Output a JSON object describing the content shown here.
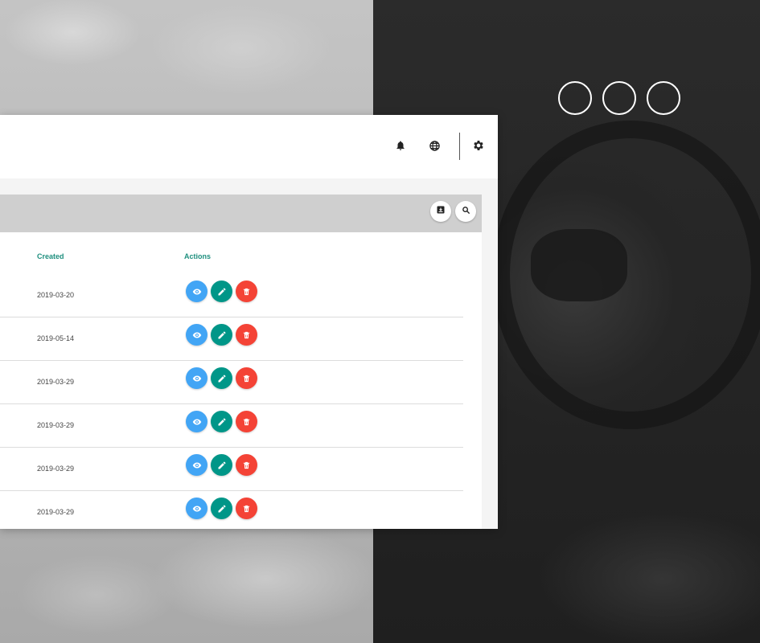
{
  "colors": {
    "accent": "#1e8f7e",
    "view": "#42a5f5",
    "edit": "#009688",
    "delete": "#f44336"
  },
  "topbar": {
    "icons": [
      "bell-icon",
      "globe-icon",
      "gear-icon"
    ]
  },
  "card_header": {
    "icons": [
      "download-icon",
      "search-icon"
    ]
  },
  "table": {
    "columns": {
      "created": "Created",
      "actions": "Actions"
    },
    "rows": [
      {
        "created": "2019-03-20"
      },
      {
        "created": "2019-05-14"
      },
      {
        "created": "2019-03-29"
      },
      {
        "created": "2019-03-29"
      },
      {
        "created": "2019-03-29"
      },
      {
        "created": "2019-03-29"
      }
    ]
  }
}
